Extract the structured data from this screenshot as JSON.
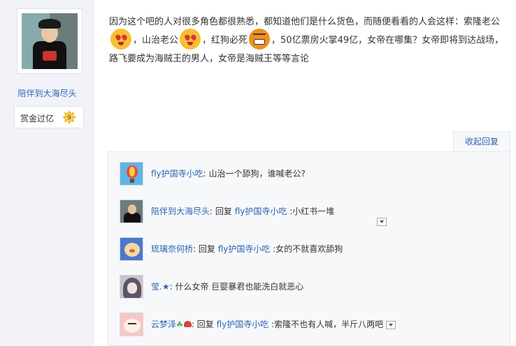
{
  "author": {
    "name": "陪伴到大海尽头",
    "rank_label": "赏金过亿",
    "rank_level": "9"
  },
  "post": {
    "segments": [
      "因为这个吧的人对很多角色都很熟悉，都知道他们是什么货色，而随便看看的人会这样：索隆老公",
      "，山治老公",
      "，红狗必死",
      "，50亿票房火掌49亿，女帝在哪集？女帝即将到达战场，路飞要成为海贼王的男人，女帝是海贼王等等言论"
    ],
    "emojis": [
      "heart-eyes-emoji",
      "heart-eyes-emoji",
      "angry-emoji"
    ]
  },
  "reply_panel": {
    "collapse_label": "收起回复",
    "replies": [
      {
        "user": "fly护国寺小吃",
        "prefix": "",
        "target": "",
        "text": "山治一个舔狗，谁喊老公?"
      },
      {
        "user": "陪伴到大海尽头",
        "prefix": "回复",
        "target": "fly护国寺小吃",
        "text": ":小红书一堆"
      },
      {
        "user": "琉璃奈何桥",
        "prefix": "回复",
        "target": "fly护国寺小吃",
        "text": ":女的不就喜欢舔狗"
      },
      {
        "user": "莹.★",
        "prefix": "",
        "target": "",
        "text": "什么女帝 巨婴暴君也能洗白就恶心"
      },
      {
        "user": "云梦泽",
        "prefix": "回复",
        "target": "fly护国寺小吃",
        "text": ":索隆不也有人喊，半斤八两吧"
      }
    ]
  },
  "colors": {
    "link": "#2d64b3",
    "sidebar_bg": "#f1f3f8",
    "reply_bg": "#f7f8fa"
  }
}
